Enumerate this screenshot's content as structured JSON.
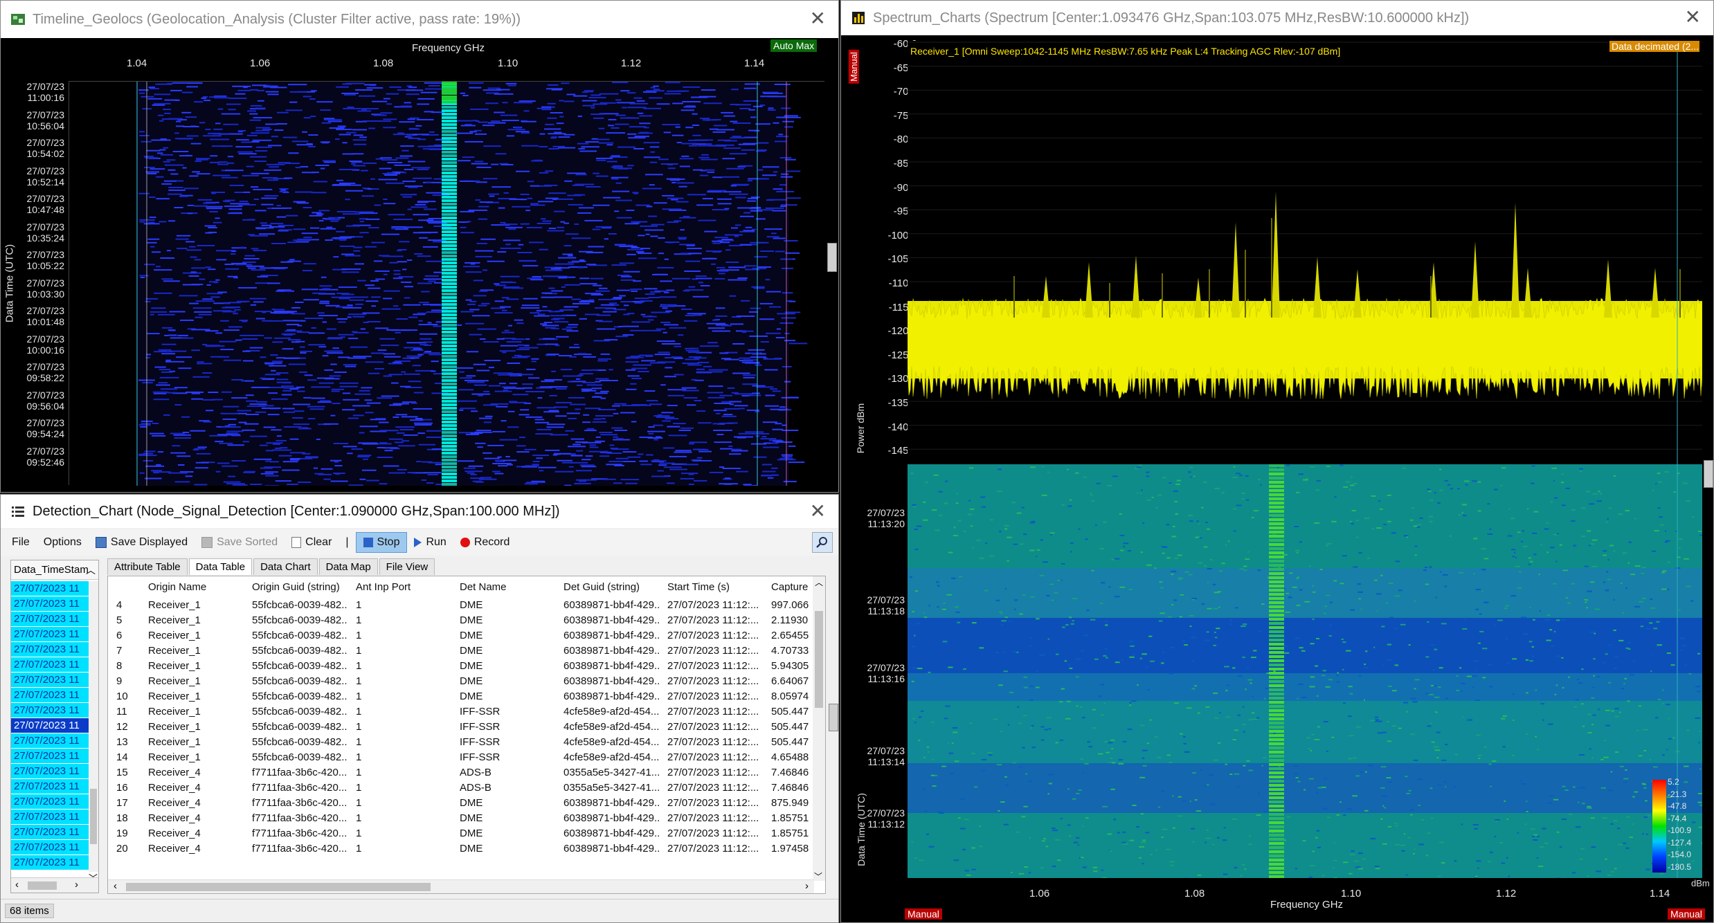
{
  "timeline": {
    "title": "Timeline_Geolocs (Geolocation_Analysis (Cluster Filter active, pass rate: 19%))",
    "x_axis_title": "Frequency GHz",
    "x_ticks": [
      "1.04",
      "1.06",
      "1.08",
      "1.10",
      "1.12",
      "1.14"
    ],
    "auto_max": "Auto Max",
    "y_axis_title": "Data Time (UTC)",
    "time_labels": [
      {
        "d": "27/07/23",
        "t": "11:00:16"
      },
      {
        "d": "27/07/23",
        "t": "10:56:04"
      },
      {
        "d": "27/07/23",
        "t": "10:54:02"
      },
      {
        "d": "27/07/23",
        "t": "10:52:14"
      },
      {
        "d": "27/07/23",
        "t": "10:47:48"
      },
      {
        "d": "27/07/23",
        "t": "10:35:24"
      },
      {
        "d": "27/07/23",
        "t": "10:05:22"
      },
      {
        "d": "27/07/23",
        "t": "10:03:30"
      },
      {
        "d": "27/07/23",
        "t": "10:01:48"
      },
      {
        "d": "27/07/23",
        "t": "10:00:16"
      },
      {
        "d": "27/07/23",
        "t": "09:58:22"
      },
      {
        "d": "27/07/23",
        "t": "09:56:04"
      },
      {
        "d": "27/07/23",
        "t": "09:54:24"
      },
      {
        "d": "27/07/23",
        "t": "09:52:46"
      }
    ]
  },
  "detection": {
    "title": "Detection_Chart (Node_Signal_Detection [Center:1.090000 GHz,Span:100.000 MHz])",
    "toolbar": {
      "file": "File",
      "options": "Options",
      "save_displayed": "Save Displayed",
      "save_sorted": "Save Sorted",
      "clear": "Clear",
      "separator": "|",
      "stop": "Stop",
      "run": "Run",
      "record": "Record"
    },
    "left_header": "Data_TimeStam",
    "left_items": [
      "27/07/2023 11",
      "27/07/2023 11",
      "27/07/2023 11",
      "27/07/2023 11",
      "27/07/2023 11",
      "27/07/2023 11",
      "27/07/2023 11",
      "27/07/2023 11",
      "27/07/2023 11",
      "27/07/2023 11",
      "27/07/2023 11",
      "27/07/2023 11",
      "27/07/2023 11",
      "27/07/2023 11",
      "27/07/2023 11",
      "27/07/2023 11",
      "27/07/2023 11",
      "27/07/2023 11",
      "27/07/2023 11"
    ],
    "left_selected_index": 9,
    "tabs": [
      "Attribute Table",
      "Data Table",
      "Data Chart",
      "Data Map",
      "File View"
    ],
    "selected_tab": 1,
    "columns": [
      "Origin Name",
      "Origin Guid (string)",
      "Ant Inp Port",
      "Det Name",
      "Det Guid (string)",
      "Start Time (s)",
      "Capture"
    ],
    "rows": [
      [
        "4",
        "Receiver_1",
        "55fcbca6-0039-482...",
        "1",
        "DME",
        "60389871-bb4f-429...",
        "27/07/2023 11:12:...",
        "997.066"
      ],
      [
        "5",
        "Receiver_1",
        "55fcbca6-0039-482...",
        "1",
        "DME",
        "60389871-bb4f-429...",
        "27/07/2023 11:12:...",
        "2.11930"
      ],
      [
        "6",
        "Receiver_1",
        "55fcbca6-0039-482...",
        "1",
        "DME",
        "60389871-bb4f-429...",
        "27/07/2023 11:12:...",
        "2.65455"
      ],
      [
        "7",
        "Receiver_1",
        "55fcbca6-0039-482...",
        "1",
        "DME",
        "60389871-bb4f-429...",
        "27/07/2023 11:12:...",
        "4.70733"
      ],
      [
        "8",
        "Receiver_1",
        "55fcbca6-0039-482...",
        "1",
        "DME",
        "60389871-bb4f-429...",
        "27/07/2023 11:12:...",
        "5.94305"
      ],
      [
        "9",
        "Receiver_1",
        "55fcbca6-0039-482...",
        "1",
        "DME",
        "60389871-bb4f-429...",
        "27/07/2023 11:12:...",
        "6.64067"
      ],
      [
        "10",
        "Receiver_1",
        "55fcbca6-0039-482...",
        "1",
        "DME",
        "60389871-bb4f-429...",
        "27/07/2023 11:12:...",
        "8.05974"
      ],
      [
        "11",
        "Receiver_1",
        "55fcbca6-0039-482...",
        "1",
        "IFF-SSR",
        "4cfe58e9-af2d-454...",
        "27/07/2023 11:12:...",
        "505.447"
      ],
      [
        "12",
        "Receiver_1",
        "55fcbca6-0039-482...",
        "1",
        "IFF-SSR",
        "4cfe58e9-af2d-454...",
        "27/07/2023 11:12:...",
        "505.447"
      ],
      [
        "13",
        "Receiver_1",
        "55fcbca6-0039-482...",
        "1",
        "IFF-SSR",
        "4cfe58e9-af2d-454...",
        "27/07/2023 11:12:...",
        "505.447"
      ],
      [
        "14",
        "Receiver_1",
        "55fcbca6-0039-482...",
        "1",
        "IFF-SSR",
        "4cfe58e9-af2d-454...",
        "27/07/2023 11:12:...",
        "4.65488"
      ],
      [
        "15",
        "Receiver_4",
        "f7711faa-3b6c-420...",
        "1",
        "ADS-B",
        "0355a5e5-3427-41...",
        "27/07/2023 11:12:...",
        "7.46846"
      ],
      [
        "16",
        "Receiver_4",
        "f7711faa-3b6c-420...",
        "1",
        "ADS-B",
        "0355a5e5-3427-41...",
        "27/07/2023 11:12:...",
        "7.46846"
      ],
      [
        "17",
        "Receiver_4",
        "f7711faa-3b6c-420...",
        "1",
        "DME",
        "60389871-bb4f-429...",
        "27/07/2023 11:12:...",
        "875.949"
      ],
      [
        "18",
        "Receiver_4",
        "f7711faa-3b6c-420...",
        "1",
        "DME",
        "60389871-bb4f-429...",
        "27/07/2023 11:12:...",
        "1.85751"
      ],
      [
        "19",
        "Receiver_4",
        "f7711faa-3b6c-420...",
        "1",
        "DME",
        "60389871-bb4f-429...",
        "27/07/2023 11:12:...",
        "1.85751"
      ],
      [
        "20",
        "Receiver_4",
        "f7711faa-3b6c-420...",
        "1",
        "DME",
        "60389871-bb4f-429...",
        "27/07/2023 11:12:...",
        "1.97458"
      ]
    ],
    "status": "68 items"
  },
  "spectrum": {
    "title": "Spectrum_Charts (Spectrum [Center:1.093476 GHz,Span:103.075 MHz,ResBW:10.600000 kHz])",
    "trace_label": "Receiver_1 [Omni Sweep:1042-1145 MHz ResBW:7.65 kHz Peak L:4 Tracking AGC Rlev:-107 dBm]",
    "data_decimated": "Data decimated (2...",
    "manual": "Manual",
    "y_axis_title": "Power dBm",
    "y_ticks": [
      "-60.0",
      "-65.0",
      "-70.0",
      "-75.0",
      "-80.0",
      "-85.0",
      "-90.0",
      "-95.0",
      "-100.0",
      "-105.0",
      "-110.0",
      "-115.0",
      "-120.0",
      "-125.0",
      "-130.0",
      "-135.0",
      "-140.0",
      "-145.0"
    ],
    "wf_y_title": "Data Time (UTC)",
    "wf_time_labels": [
      {
        "d": "27/07/23",
        "t": "11:13:20"
      },
      {
        "d": "27/07/23",
        "t": "11:13:18"
      },
      {
        "d": "27/07/23",
        "t": "11:13:16"
      },
      {
        "d": "27/07/23",
        "t": "11:13:14"
      },
      {
        "d": "27/07/23",
        "t": "11:13:12"
      }
    ],
    "x_ticks": [
      "1.06",
      "1.08",
      "1.10",
      "1.12",
      "1.14"
    ],
    "x_axis_title": "Frequency GHz",
    "colorbar_ticks": [
      "5.2",
      "-21.3",
      "-47.8",
      "-74.4",
      "-100.9",
      "-127.4",
      "-154.0",
      "-180.5"
    ],
    "colorbar_unit": "dBm",
    "manual_left": "Manual",
    "manual_right": "Manual"
  }
}
